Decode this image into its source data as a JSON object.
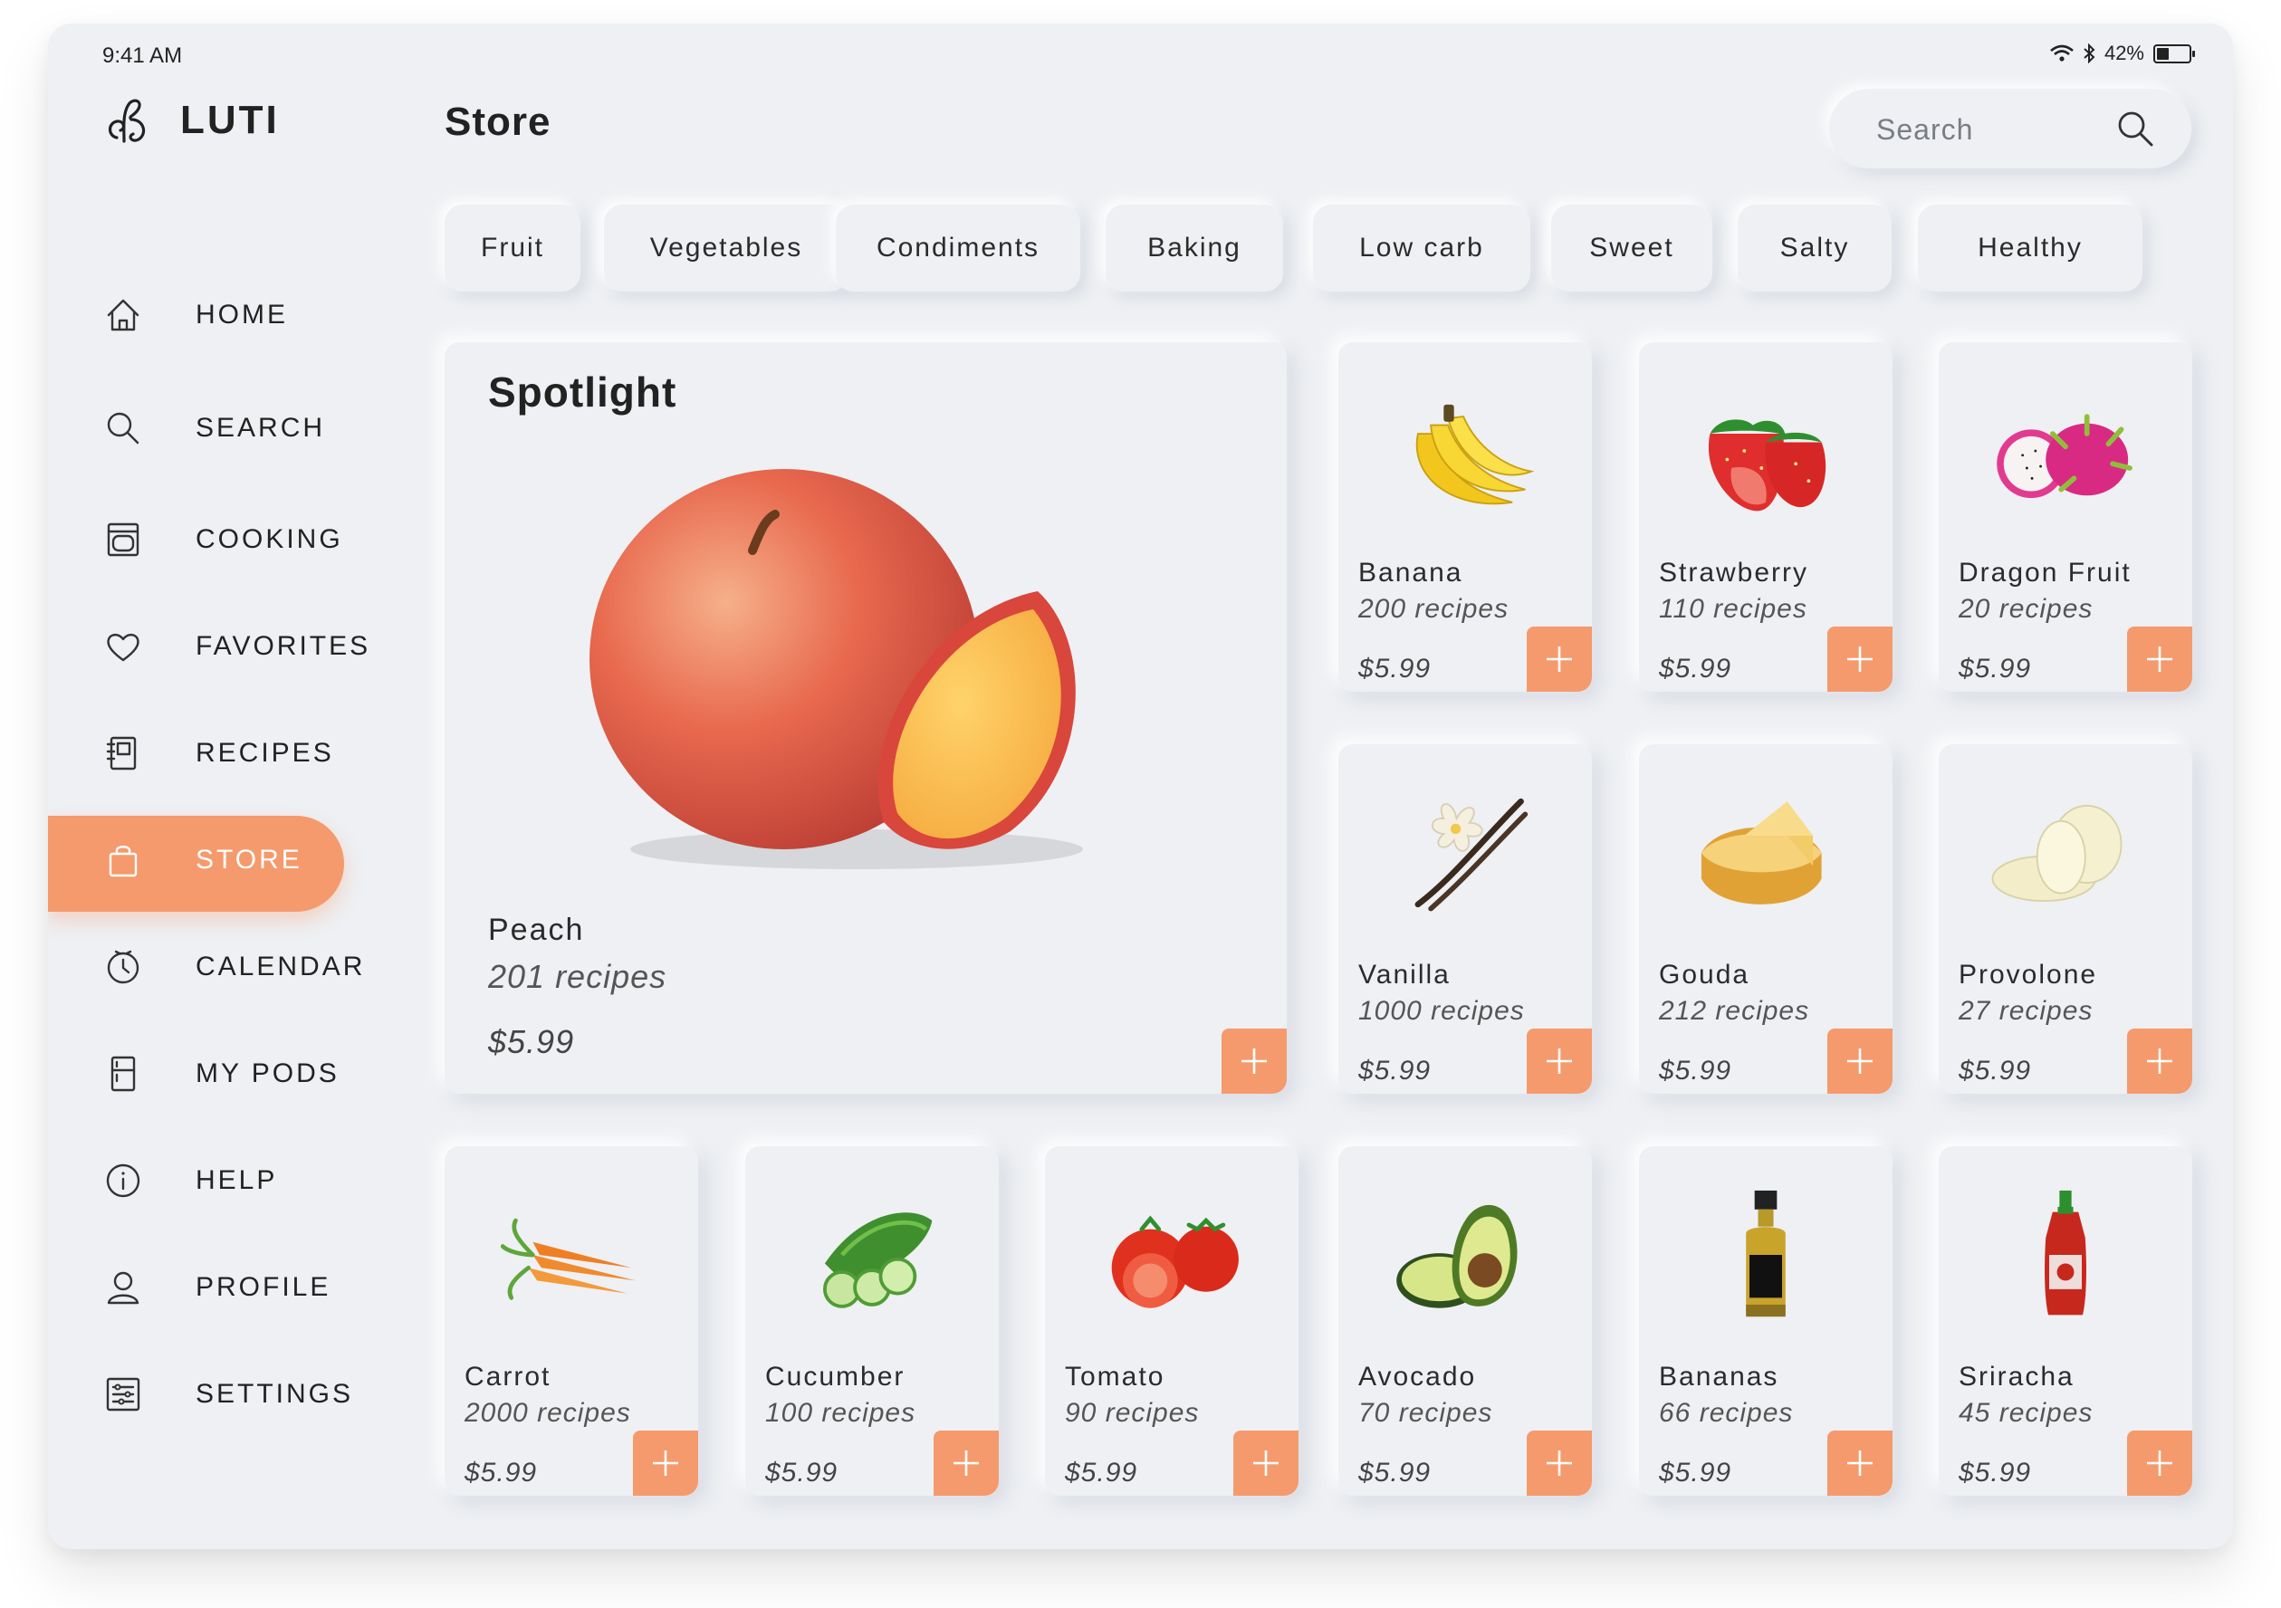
{
  "status": {
    "time": "9:41 AM",
    "battery": "42%",
    "battery_level": 0.42
  },
  "app": {
    "name": "LUTI"
  },
  "sidebar": {
    "items": [
      {
        "label": "HOME",
        "icon": "home-icon"
      },
      {
        "label": "SEARCH",
        "icon": "search-icon"
      },
      {
        "label": "COOKING",
        "icon": "oven-icon"
      },
      {
        "label": "FAVORITES",
        "icon": "heart-icon"
      },
      {
        "label": "RECIPES",
        "icon": "recipe-book-icon"
      },
      {
        "label": "STORE",
        "icon": "shopping-bag-icon",
        "active": true
      },
      {
        "label": "CALENDAR",
        "icon": "clock-icon"
      },
      {
        "label": "MY PODS",
        "icon": "fridge-icon"
      },
      {
        "label": "HELP",
        "icon": "info-icon"
      },
      {
        "label": "PROFILE",
        "icon": "user-icon"
      },
      {
        "label": "SETTINGS",
        "icon": "settings-sliders-icon"
      }
    ]
  },
  "header": {
    "title": "Store",
    "search_placeholder": "Search"
  },
  "categories": [
    "Fruit",
    "Vegetables",
    "Condiments",
    "Baking",
    "Low carb",
    "Sweet",
    "Salty",
    "Healthy"
  ],
  "spotlight": {
    "title": "Spotlight",
    "name": "Peach",
    "recipes": "201 recipes",
    "price": "$5.99",
    "image": "peach-image"
  },
  "products": [
    {
      "name": "Banana",
      "recipes": "200 recipes",
      "price": "$5.99",
      "image": "banana-image"
    },
    {
      "name": "Strawberry",
      "recipes": "110 recipes",
      "price": "$5.99",
      "image": "strawberry-image"
    },
    {
      "name": "Dragon Fruit",
      "recipes": "20 recipes",
      "price": "$5.99",
      "image": "dragon-fruit-image"
    },
    {
      "name": "Vanilla",
      "recipes": "1000 recipes",
      "price": "$5.99",
      "image": "vanilla-image"
    },
    {
      "name": "Gouda",
      "recipes": "212 recipes",
      "price": "$5.99",
      "image": "gouda-image"
    },
    {
      "name": "Provolone",
      "recipes": "27 recipes",
      "price": "$5.99",
      "image": "provolone-image"
    },
    {
      "name": "Carrot",
      "recipes": "2000 recipes",
      "price": "$5.99",
      "image": "carrot-image"
    },
    {
      "name": "Cucumber",
      "recipes": "100 recipes",
      "price": "$5.99",
      "image": "cucumber-image"
    },
    {
      "name": "Tomato",
      "recipes": "90 recipes",
      "price": "$5.99",
      "image": "tomato-image"
    },
    {
      "name": "Avocado",
      "recipes": "70 recipes",
      "price": "$5.99",
      "image": "avocado-image"
    },
    {
      "name": "Bananas",
      "recipes": "66 recipes",
      "price": "$5.99",
      "image": "oil-bottle-image"
    },
    {
      "name": "Sriracha",
      "recipes": "45 recipes",
      "price": "$5.99",
      "image": "sriracha-image"
    }
  ],
  "colors": {
    "accent": "#f59a6d",
    "background": "#eef0f3",
    "text": "#2b2b2b"
  }
}
